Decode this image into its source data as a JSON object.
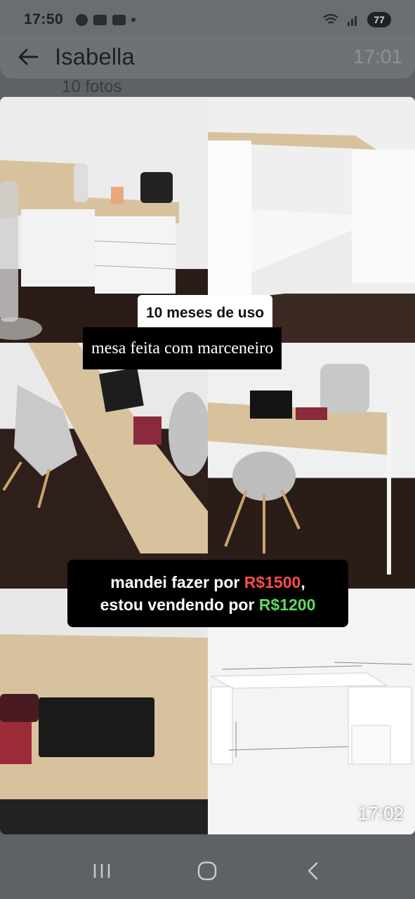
{
  "status_bar": {
    "time": "17:50",
    "battery": "77"
  },
  "header": {
    "contact_name": "Isabella",
    "time": "17:01",
    "subtitle": "10 fotos"
  },
  "photo": {
    "caption_usage": "10 meses de uso",
    "caption_desc": "mesa feita com marceneiro",
    "price_line1_text": "mandei fazer por ",
    "price_line1_price": "R$1500",
    "price_line1_suffix": ",",
    "price_line2_text": "estou vendendo por ",
    "price_line2_price": "R$1200",
    "timestamp": "17:02"
  },
  "colors": {
    "old_price": "#ff4b4b",
    "new_price": "#5edb5e"
  },
  "icons": [
    "back-arrow-icon",
    "recent-apps-icon",
    "home-icon",
    "nav-back-icon"
  ]
}
